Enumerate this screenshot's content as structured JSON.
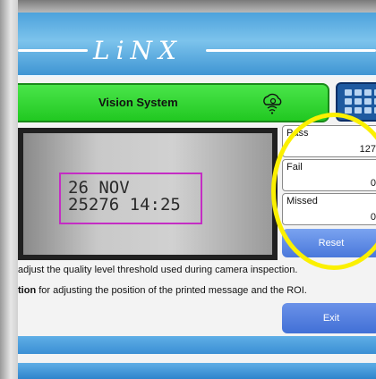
{
  "logo": {
    "text": "LiNX"
  },
  "header": {
    "title": "Vision System",
    "cloud_icon": "cloud-gear-icon"
  },
  "keypad": {
    "icon": "keypad-icon"
  },
  "camera": {
    "line1": "26 NOV",
    "line2": "25276 14:25"
  },
  "stats": {
    "pass": {
      "label": "Pass",
      "value": "127"
    },
    "fail": {
      "label": "Fail",
      "value": "0"
    },
    "missed": {
      "label": "Missed",
      "value": "0"
    }
  },
  "buttons": {
    "reset": "Reset",
    "exit": "Exit"
  },
  "help": {
    "line1": " adjust the quality level threshold used during camera inspection.",
    "line2_bold": "tion",
    "line2_rest": " for adjusting the position of the printed message and the ROI."
  },
  "colors": {
    "header": "#4da2dc",
    "status_bar": "#2fd12f",
    "highlight_ring": "#fbf000",
    "roi": "#c42dc4",
    "button": "#4a78db"
  }
}
